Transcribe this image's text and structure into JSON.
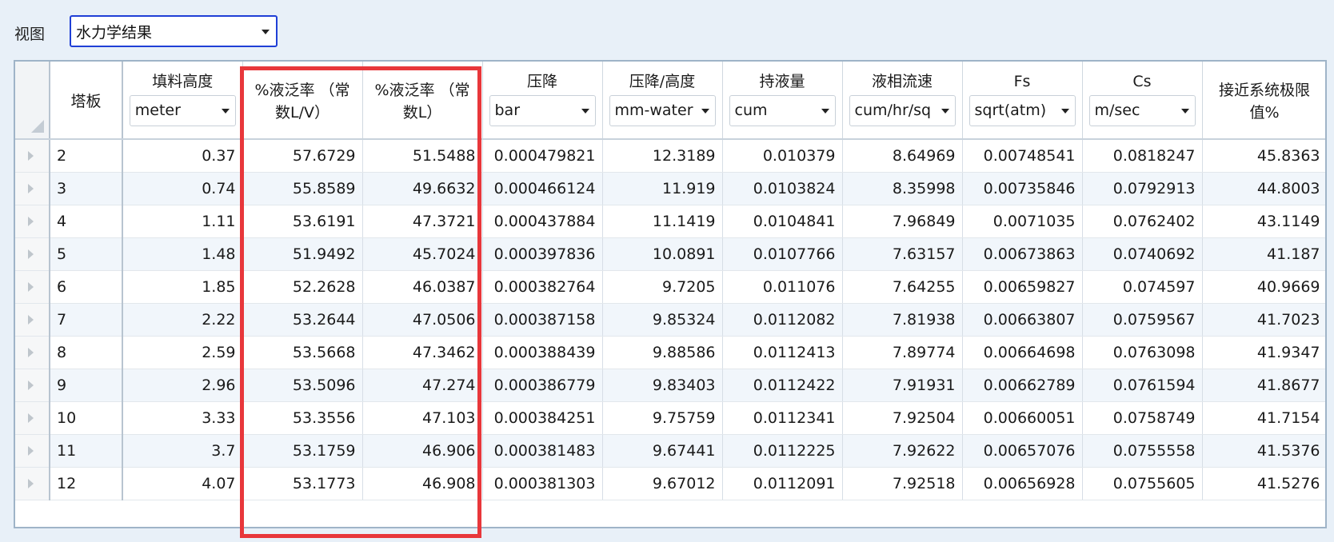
{
  "view": {
    "label": "视图",
    "selected": "水力学结果"
  },
  "grid": {
    "tray_header": "塔板",
    "columns": [
      {
        "title": "填料高度",
        "unit": "meter"
      },
      {
        "title": "%液泛率 （常数L/V）",
        "unit": null
      },
      {
        "title": "%液泛率 （常数L）",
        "unit": null
      },
      {
        "title": "压降",
        "unit": "bar"
      },
      {
        "title": "压降/高度",
        "unit": "mm-water"
      },
      {
        "title": "持液量",
        "unit": "cum"
      },
      {
        "title": "液相流速",
        "unit": "cum/hr/sq"
      },
      {
        "title": "Fs",
        "unit": "sqrt(atm)"
      },
      {
        "title": "Cs",
        "unit": "m/sec"
      },
      {
        "title": "接近系统极限值%",
        "unit": null
      }
    ],
    "rows": [
      [
        "2",
        "0.37",
        "57.6729",
        "51.5488",
        "0.000479821",
        "12.3189",
        "0.010379",
        "8.64969",
        "0.00748541",
        "0.0818247",
        "45.8363"
      ],
      [
        "3",
        "0.74",
        "55.8589",
        "49.6632",
        "0.000466124",
        "11.919",
        "0.0103824",
        "8.35998",
        "0.00735846",
        "0.0792913",
        "44.8003"
      ],
      [
        "4",
        "1.11",
        "53.6191",
        "47.3721",
        "0.000437884",
        "11.1419",
        "0.0104841",
        "7.96849",
        "0.0071035",
        "0.0762402",
        "43.1149"
      ],
      [
        "5",
        "1.48",
        "51.9492",
        "45.7024",
        "0.000397836",
        "10.0891",
        "0.0107766",
        "7.63157",
        "0.00673863",
        "0.0740692",
        "41.187"
      ],
      [
        "6",
        "1.85",
        "52.2628",
        "46.0387",
        "0.000382764",
        "9.7205",
        "0.011076",
        "7.64255",
        "0.00659827",
        "0.074597",
        "40.9669"
      ],
      [
        "7",
        "2.22",
        "53.2644",
        "47.0506",
        "0.000387158",
        "9.85324",
        "0.0112082",
        "7.81938",
        "0.00663807",
        "0.0759567",
        "41.7023"
      ],
      [
        "8",
        "2.59",
        "53.5668",
        "47.3462",
        "0.000388439",
        "9.88586",
        "0.0112413",
        "7.89774",
        "0.00664698",
        "0.0763098",
        "41.9347"
      ],
      [
        "9",
        "2.96",
        "53.5096",
        "47.274",
        "0.000386779",
        "9.83403",
        "0.0112422",
        "7.91931",
        "0.00662789",
        "0.0761594",
        "41.8677"
      ],
      [
        "10",
        "3.33",
        "53.3556",
        "47.103",
        "0.000384251",
        "9.75759",
        "0.0112341",
        "7.92504",
        "0.00660051",
        "0.0758749",
        "41.7154"
      ],
      [
        "11",
        "3.7",
        "53.1759",
        "46.906",
        "0.000381483",
        "9.67441",
        "0.0112225",
        "7.92622",
        "0.00657076",
        "0.0755558",
        "41.5376"
      ],
      [
        "12",
        "4.07",
        "53.1773",
        "46.908",
        "0.000381303",
        "9.67012",
        "0.0112091",
        "7.92518",
        "0.00656928",
        "0.0755605",
        "41.5276"
      ]
    ]
  },
  "colors": {
    "highlight": "#e8373b",
    "select_border": "#1f3fd6",
    "alt_row": "#f1f6fb"
  }
}
